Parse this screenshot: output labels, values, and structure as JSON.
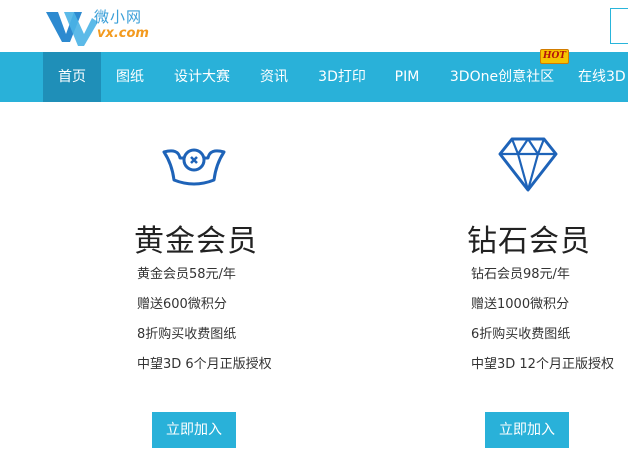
{
  "brand": {
    "name_cn": "微小网",
    "name_en": "vx.com"
  },
  "nav": {
    "items": [
      {
        "label": "首页"
      },
      {
        "label": "图纸"
      },
      {
        "label": "设计大赛"
      },
      {
        "label": "资讯"
      },
      {
        "label": "3D打印"
      },
      {
        "label": "PIM"
      },
      {
        "label": "3DOne创意社区"
      },
      {
        "label": "在线3D"
      }
    ],
    "hot_badge": "HOT",
    "accent_color": "#29b1d9",
    "active_color": "#1f8fb8"
  },
  "plans": [
    {
      "title": "黄金会员",
      "icon": "gold-ingot-icon",
      "benefits": [
        "黄金会员58元/年",
        "赠送600微积分",
        "8折购买收费图纸",
        "中望3D 6个月正版授权"
      ],
      "button": "立即加入"
    },
    {
      "title": "钻石会员",
      "icon": "diamond-icon",
      "benefits": [
        "钻石会员98元/年",
        "赠送1000微积分",
        "6折购买收费图纸",
        "中望3D 12个月正版授权"
      ],
      "button": "立即加入"
    }
  ]
}
